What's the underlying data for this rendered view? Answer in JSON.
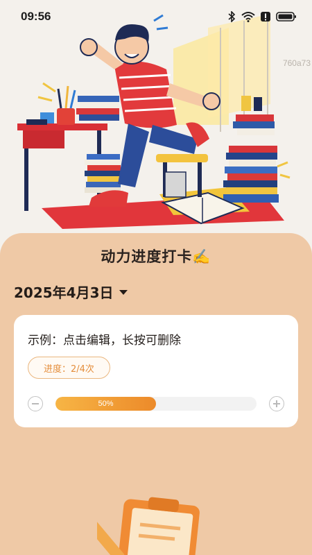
{
  "status_bar": {
    "time": "09:56",
    "icons": [
      "bluetooth-icon",
      "wifi-icon",
      "alert-icon",
      "battery-icon"
    ]
  },
  "hero": {
    "code_text": "760a73",
    "description_icon": "running-student-illustration"
  },
  "panel": {
    "title": "动力进度打卡✍️",
    "date": "2025年4月3日"
  },
  "task_card": {
    "title": "示例：点击编辑，长按可删除",
    "progress_label": "进度：2/4次",
    "progress_fraction": 0.5,
    "progress_percent_text": "50%"
  },
  "colors": {
    "panel_bg": "#efc9a6",
    "accent_orange": "#ec8a2a",
    "badge_text": "#e48d3b"
  }
}
